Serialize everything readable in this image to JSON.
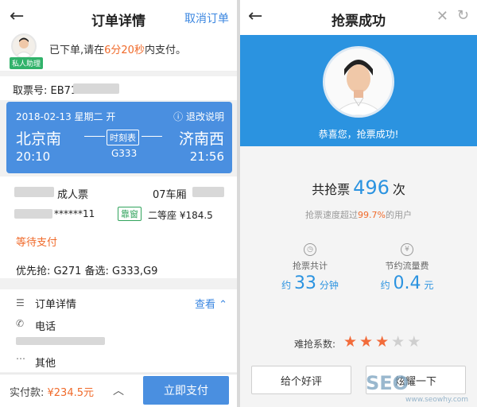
{
  "order": {
    "header": {
      "title": "订单详情",
      "cancel_label": "取消订单"
    },
    "notice": {
      "assistant_badge": "私人助理",
      "prefix": "已下单,请在",
      "time": "6分20秒",
      "suffix": "内支付。"
    },
    "ticket_no": {
      "label": "取票号: EB71"
    },
    "train": {
      "date": "2018-02-13 星期二 开",
      "refund_label": "退改说明",
      "from": "北京南",
      "to": "济南西",
      "depart": "20:10",
      "arrive": "21:56",
      "schedule_label": "时刻表",
      "train_no": "G333"
    },
    "passenger": {
      "type": "成人票",
      "car": "07车厢",
      "id_no": "******11",
      "window_badge": "靠窗",
      "seat_price": "二等座 ¥184.5",
      "status": "等待支付",
      "priority": "优先抢: G271  备选: G333,G9"
    },
    "details": {
      "title": "订单详情",
      "view_label": "查看",
      "phone_label": "电话",
      "other_label": "其他"
    },
    "footer": {
      "pay_label": "实付款: ",
      "pay_amount": "¥234.5元",
      "pay_button": "立即支付"
    }
  },
  "success": {
    "header": {
      "title": "抢票成功"
    },
    "congrats": "恭喜您，抢票成功!",
    "grab_prefix": "共抢票",
    "grab_count": "496",
    "grab_suffix": "次",
    "speed_prefix": "抢票速度超过",
    "speed_pct": "99.7%",
    "speed_suffix": "的用户",
    "time_caption": "抢票共计",
    "time_prefix": "约",
    "time_value": "33",
    "time_unit": "分钟",
    "traffic_caption": "节约流量费",
    "traffic_prefix": "约",
    "traffic_value": "0.4",
    "traffic_unit": "元",
    "difficulty_label": "难抢系数:",
    "difficulty_stars": 3,
    "difficulty_max": 5,
    "review_button": "给个好评",
    "share_button": "炫耀一下"
  },
  "watermark": {
    "main": "SEO",
    "sub": "www.seowhy.com"
  },
  "colors": {
    "accent": "#4a8fe0",
    "banner": "#2b93e0",
    "warning": "#f06a2a",
    "green": "#31b26a"
  }
}
